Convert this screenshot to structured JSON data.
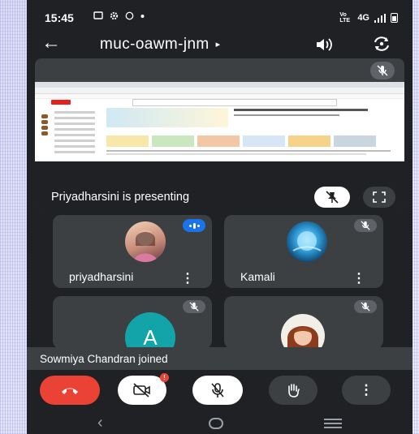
{
  "status_bar": {
    "time": "15:45",
    "network": "4G",
    "signal_label": "Vo LTE"
  },
  "top_bar": {
    "meeting_code": "muc-oawm-jnm",
    "code_arrow": "▸"
  },
  "presentation": {
    "label": "Priyadharsini is presenting"
  },
  "participants": [
    {
      "name": "priyadharsini",
      "status": "speaking",
      "menu": "⋮"
    },
    {
      "name": "Kamali",
      "status": "muted",
      "menu": "⋮"
    },
    {
      "name": "",
      "initial": "A",
      "status": "muted",
      "avatar_color": "#12a4a8"
    },
    {
      "name": "",
      "status": "muted"
    }
  ],
  "toast": {
    "message": "Sowmiya Chandran joined"
  },
  "controls": {
    "camera_badge": "!",
    "more": "⋮"
  },
  "colors": {
    "end_call": "#ea4335",
    "active_speaker": "#1a73e8",
    "tile_bg": "#3c4043",
    "screen_bg": "#202124"
  },
  "icons": [
    "back-arrow-icon",
    "speaker-icon",
    "switch-camera-icon",
    "mic-off-icon",
    "unpin-icon",
    "fullscreen-icon",
    "end-call-icon",
    "camera-off-icon",
    "raise-hand-icon",
    "more-options-icon"
  ]
}
